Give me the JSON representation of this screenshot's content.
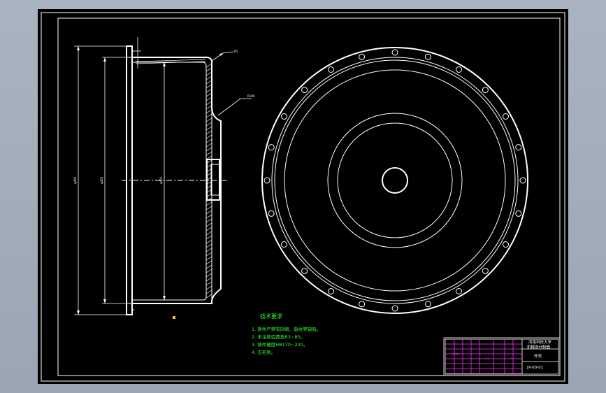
{
  "drawing": {
    "background": "#000000",
    "line_color": "#ffffff",
    "note_color": "#33ff33",
    "titleblock_accent": "#ff33ff",
    "dimensions": [
      "φ490",
      "φ450",
      "φ420"
    ],
    "leaders": [
      "R5",
      "R100"
    ],
    "technical_requirements": {
      "title": "技术要求",
      "lines": [
        "1. 铸件严禁有砂眼、裂纹等缺陷。",
        "2. 未注铸造圆角R3~R5。",
        "3. 铸件硬度HB170~220。",
        "4. 去毛刺。"
      ]
    },
    "title_block": {
      "school": "河南科技大学",
      "school_sub": "机械设计制造",
      "part_name": "外壳",
      "drawing_no": "JX-00-01",
      "material": "HT200",
      "scale": "1:1",
      "sheet": "1"
    }
  }
}
